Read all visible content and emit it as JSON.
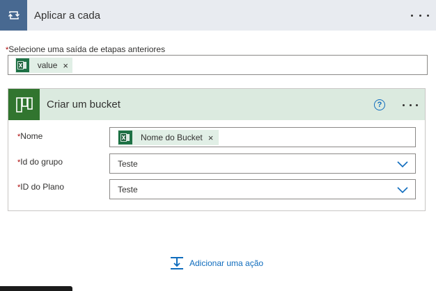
{
  "apply_each": {
    "title": "Aplicar a cada",
    "header_color": "#e8ebf0",
    "icon_color": "#486991",
    "icon": "loop-icon",
    "more_icon": "more-dots-icon"
  },
  "select_output": {
    "required_marker": "*",
    "label": "Selecione uma saída de etapas anteriores",
    "tokens": [
      {
        "label": "value",
        "icon": "excel-icon",
        "remove": "×"
      }
    ]
  },
  "create_bucket": {
    "title": "Criar um bucket",
    "header_color": "#dbeadf",
    "icon_color": "#31752f",
    "icon": "planner-icon",
    "help": "?",
    "more_icon": "more-dots-icon",
    "fields": [
      {
        "required_marker": "*",
        "label": "Nome",
        "type": "token",
        "token_label": "Nome do Bucket",
        "token_remove": "×"
      },
      {
        "required_marker": "*",
        "label": "Id do grupo",
        "type": "select",
        "value": "Teste"
      },
      {
        "required_marker": "*",
        "label": "ID do Plano",
        "type": "select",
        "value": "Teste"
      }
    ]
  },
  "add_action": {
    "label": "Adicionar uma ação",
    "icon": "insert-step-icon",
    "color": "#0f6cbd"
  }
}
